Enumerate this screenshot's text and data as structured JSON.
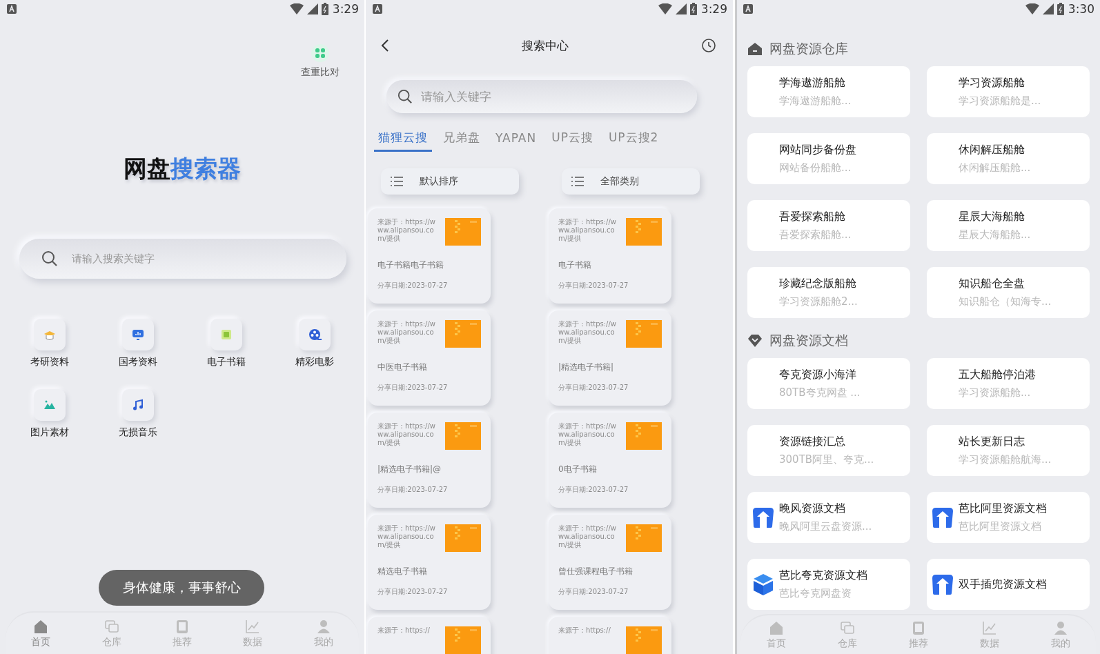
{
  "home_screen": {
    "status_bar": {
      "time": "3:29"
    },
    "compare_shortcut": {
      "label": "查重比对"
    },
    "app_title": {
      "text": "网盘",
      "accent": "搜索器"
    },
    "search": {
      "placeholder": "请输入搜索关键字"
    },
    "categories": [
      {
        "label": "考研资料",
        "kind": "cap"
      },
      {
        "label": "国考资料",
        "kind": "board"
      },
      {
        "label": "电子书籍",
        "kind": "book"
      },
      {
        "label": "精彩电影",
        "kind": "film"
      },
      {
        "label": "图片素材"
      },
      {
        "label": "无损音乐",
        "kind": "music"
      }
    ],
    "toast": "身体健康，事事舒心",
    "nav": [
      {
        "label": "首页",
        "kind": "home",
        "selected": true
      },
      {
        "label": "仓库",
        "kind": "stack",
        "selected": false
      },
      {
        "label": "推荐",
        "kind": "card",
        "selected": false
      },
      {
        "label": "数据",
        "kind": "chart",
        "selected": false
      },
      {
        "label": "我的",
        "kind": "person",
        "selected": false
      }
    ]
  },
  "search_screen": {
    "status_bar": {
      "time": "3:29"
    },
    "header": {
      "title": "搜索中心"
    },
    "search": {
      "placeholder": "请输入关键字"
    },
    "tabs": [
      {
        "label": "猫狸云搜",
        "selected": true
      },
      {
        "label": "兄弟盘",
        "selected": false
      },
      {
        "label": "YAPAN",
        "selected": false
      },
      {
        "label": "UP云搜",
        "selected": false
      },
      {
        "label": "UP云搜2",
        "selected": false
      }
    ],
    "sort_buttons": [
      "默认排序",
      "全部类别"
    ],
    "results": [
      {
        "source": "来源于：https://www.alipansou.com/提供",
        "title": "电子书籍电子书籍",
        "date": "分享日期:2023-07-27"
      },
      {
        "source": "来源于：https://www.alipansou.com/提供",
        "title": "电子书籍",
        "date": "分享日期:2023-07-27"
      },
      {
        "source": "来源于：https://www.alipansou.com/提供",
        "title": "中医电子书籍",
        "date": "分享日期:2023-07-27"
      },
      {
        "source": "来源于：https://www.alipansou.com/提供",
        "title": "|精选电子书籍|",
        "date": "分享日期:2023-07-27"
      },
      {
        "source": "来源于：https://www.alipansou.com/提供",
        "title": "|精选电子书籍|@",
        "date": "分享日期:2023-07-27"
      },
      {
        "source": "来源于：https://www.alipansou.com/提供",
        "title": "0电子书籍",
        "date": "分享日期:2023-07-27"
      },
      {
        "source": "来源于：https://www.alipansou.com/提供",
        "title": "精选电子书籍",
        "date": "分享日期:2023-07-27"
      },
      {
        "source": "来源于：https://www.alipansou.com/提供",
        "title": "曾仕强课程电子书籍",
        "date": "分享日期:2023-07-27"
      },
      {
        "source": "来源于：https://"
      },
      {
        "source": "来源于：https://"
      }
    ]
  },
  "warehouse_screen": {
    "status_bar": {
      "time": "3:30"
    },
    "sections": [
      {
        "title": "网盘资源仓库",
        "kind": "house",
        "cards": [
          {
            "title": "学海遨游船舱",
            "subtitle": "学海遨游船舱...",
            "kind": "plain"
          },
          {
            "title": "学习资源船舱",
            "subtitle": "学习资源船舱是...",
            "kind": "plain"
          },
          {
            "title": "网站同步备份盘",
            "subtitle": "网站备份船舱...",
            "kind": "plain"
          },
          {
            "title": "休闲解压船舱",
            "subtitle": "休闲解压船舱...",
            "kind": "plain"
          },
          {
            "title": "吾爱探索船舱",
            "subtitle": "吾爱探索船舱...",
            "kind": "plain"
          },
          {
            "title": "星辰大海船舱",
            "subtitle": "星辰大海船舱...",
            "kind": "plain"
          },
          {
            "title": "珍藏纪念版船舱",
            "subtitle": "学习资源船舱2...",
            "kind": "plain"
          },
          {
            "title": "知识船仓全盘",
            "subtitle": "知识船仓（知海专...",
            "kind": "plain"
          }
        ]
      },
      {
        "title": "网盘资源文档",
        "kind": "gem",
        "cards": [
          {
            "title": "夸克资源小海洋",
            "subtitle": "80TB夸克网盘 ...",
            "kind": "plain"
          },
          {
            "title": "五大船舱停泊港",
            "subtitle": "学习资源船舱...",
            "kind": "plain"
          },
          {
            "title": "资源链接汇总",
            "subtitle": "300TB阿里、夸克...",
            "kind": "plain"
          },
          {
            "title": "站长更新日志",
            "subtitle": "学习资源船舱航海...",
            "kind": "plain"
          },
          {
            "title": "晚风资源文档",
            "subtitle": "晚风阿里云盘资源...",
            "kind": "arrow-logo"
          },
          {
            "title": "芭比阿里资源文档",
            "subtitle": "芭比阿里资源文档",
            "kind": "arrow-logo"
          },
          {
            "title": "芭比夸克资源文档",
            "subtitle": "芭比夸克网盘资",
            "kind": "cube-logo"
          },
          {
            "title": "双手插兜资源文档",
            "kind": "arrow-logo"
          }
        ]
      }
    ],
    "nav": [
      {
        "label": "首页",
        "kind": "home",
        "selected": false
      },
      {
        "label": "仓库",
        "kind": "stack",
        "selected": false
      },
      {
        "label": "推荐",
        "kind": "card",
        "selected": false
      },
      {
        "label": "数据",
        "kind": "chart",
        "selected": false
      },
      {
        "label": "我的",
        "kind": "person",
        "selected": false
      }
    ]
  }
}
